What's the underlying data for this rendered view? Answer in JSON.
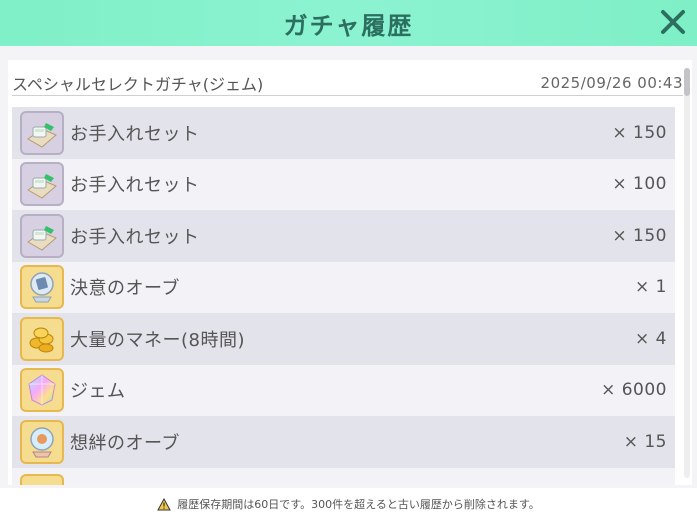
{
  "header": {
    "title": "ガチャ履歴",
    "close_icon": "close-icon"
  },
  "section": {
    "title": "スペシャルセレクトガチャ(ジェム)",
    "date": "2025/09/26 00:43"
  },
  "items": [
    {
      "name": "お手入れセット",
      "qty": "× 150",
      "icon": "care-set-icon"
    },
    {
      "name": "お手入れセット",
      "qty": "× 100",
      "icon": "care-set-icon"
    },
    {
      "name": "お手入れセット",
      "qty": "× 150",
      "icon": "care-set-icon"
    },
    {
      "name": "決意のオーブ",
      "qty": "× 1",
      "icon": "resolve-orb-icon"
    },
    {
      "name": "大量のマネー(8時間)",
      "qty": "× 4",
      "icon": "money-icon"
    },
    {
      "name": "ジェム",
      "qty": "× 6000",
      "icon": "gem-icon"
    },
    {
      "name": "想絆のオーブ",
      "qty": "× 15",
      "icon": "bond-orb-icon"
    }
  ],
  "footer": {
    "notice": "履歴保存期間は60日です。300件を超えると古い履歴から削除されます。"
  },
  "colors": {
    "header": "#7ff0c7",
    "row_shade": "#e3e3eb",
    "row_plain": "#f3f3f7",
    "accent_gold": "#e8b850"
  }
}
